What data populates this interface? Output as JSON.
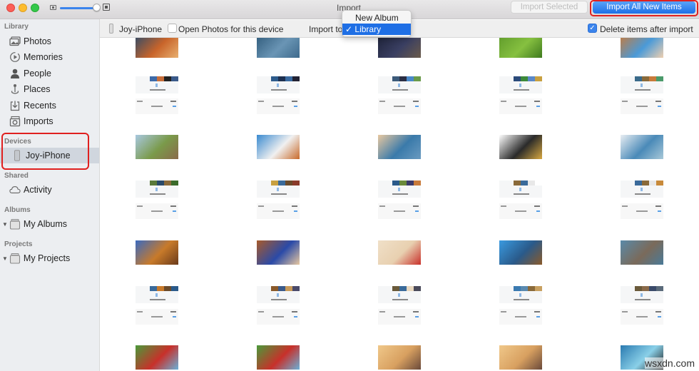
{
  "window": {
    "title": "Import",
    "zoom_slider_value_fraction": 0.9
  },
  "toolbar_top": {
    "import_selected_label": "Import Selected",
    "import_selected_enabled": false,
    "import_all_label": "Import All New Items",
    "accent_color": "#1f6fe5",
    "highlight_color": "#e0201f"
  },
  "sidebar": {
    "sections": [
      {
        "label": "Library",
        "items": [
          {
            "label": "Photos",
            "icon": "photos-icon"
          },
          {
            "label": "Memories",
            "icon": "memories-icon"
          },
          {
            "label": "People",
            "icon": "people-icon"
          },
          {
            "label": "Places",
            "icon": "places-icon"
          },
          {
            "label": "Recents",
            "icon": "recents-icon"
          },
          {
            "label": "Imports",
            "icon": "imports-icon"
          }
        ]
      },
      {
        "label": "Devices",
        "items": [
          {
            "label": "Joy-iPhone",
            "icon": "iphone-icon",
            "selected": true
          }
        ]
      },
      {
        "label": "Shared",
        "items": [
          {
            "label": "Activity",
            "icon": "cloud-icon"
          }
        ]
      },
      {
        "label": "Albums",
        "items": [
          {
            "label": "My Albums",
            "icon": "folder-icon",
            "expandable": true
          }
        ]
      },
      {
        "label": "Projects",
        "items": [
          {
            "label": "My Projects",
            "icon": "folder-icon",
            "expandable": true
          }
        ]
      }
    ]
  },
  "toolbar": {
    "device_name": "Joy-iPhone",
    "open_photos_label": "Open Photos for this device",
    "open_photos_checked": false,
    "import_to_label": "Import to",
    "import_to_options": [
      "New Album",
      "Library"
    ],
    "import_to_selected": "Library",
    "delete_after_label": "Delete items after import",
    "delete_after_checked": true
  },
  "grid": {
    "columns": 5,
    "rows": [
      {
        "type": "photo",
        "items": [
          {
            "desc": "roaring lion close-up",
            "colors": [
              "#2a4a6a",
              "#c8642a",
              "#e8b070"
            ]
          },
          {
            "desc": "blue ocean scene",
            "colors": [
              "#2f5a7a",
              "#6a95b5",
              "#3e6a8c"
            ]
          },
          {
            "desc": "night pirate ship",
            "colors": [
              "#1d2238",
              "#3a3f62",
              "#6a5a4a"
            ]
          },
          {
            "desc": "green meadow",
            "colors": [
              "#5e9a2a",
              "#86c040",
              "#3f7a1e"
            ]
          },
          {
            "desc": "cartoon collage",
            "colors": [
              "#c87a3a",
              "#4a9ad8",
              "#f0d0b0"
            ]
          }
        ]
      },
      {
        "type": "screenshot-strip",
        "items": [
          {
            "colors": [
              "#3d6aa8",
              "#c86e3a",
              "#222",
              "#3a5a8a"
            ]
          },
          {
            "colors": [
              "#2e5c8c",
              "#1e3050",
              "#3a6aa0",
              "#223"
            ]
          },
          {
            "colors": [
              "#3c5a7a",
              "#2a2e44",
              "#4a88c8",
              "#6a9a4a"
            ]
          },
          {
            "colors": [
              "#2a4a7a",
              "#3c8a3a",
              "#5a88c8",
              "#c8a040"
            ]
          },
          {
            "colors": [
              "#3a6a8a",
              "#8a6a3a",
              "#c87a3a",
              "#4a9a6a"
            ]
          }
        ]
      },
      {
        "type": "info-card",
        "items": [
          {},
          {},
          {},
          {},
          {}
        ]
      },
      {
        "type": "photo",
        "items": [
          {
            "desc": "donkey cartoon",
            "colors": [
              "#a8c8e0",
              "#7a9a4a",
              "#8a6a4a"
            ]
          },
          {
            "desc": "panda cartoon",
            "colors": [
              "#3a8ad0",
              "#f0f0f0",
              "#c86a2a"
            ]
          },
          {
            "desc": "ocean wave",
            "colors": [
              "#e8c8a0",
              "#3a7aaa",
              "#6a9ac0"
            ]
          },
          {
            "desc": "wedding with minions",
            "colors": [
              "#ffffff",
              "#2a2a2a",
              "#d8a840"
            ]
          },
          {
            "desc": "whale illustration",
            "colors": [
              "#e8eef2",
              "#4a8ab8",
              "#a8c8d8"
            ]
          }
        ]
      },
      {
        "type": "screenshot-strip",
        "items": [
          {
            "colors": [
              "#5a7a3a",
              "#2a4a6a",
              "#8a6a3a",
              "#3a6a2a"
            ]
          },
          {
            "colors": [
              "#c8a040",
              "#3a6a9a",
              "#6a4a2a",
              "#8a3a2a"
            ]
          },
          {
            "colors": [
              "#2a5a8a",
              "#6a8a3a",
              "#3a3a6a",
              "#c87a3a"
            ]
          },
          {
            "colors": [
              "#8a6a3a",
              "#3a6a9a",
              "#e8e8e8",
              "#ffffff"
            ]
          },
          {
            "colors": [
              "#3a6a9a",
              "#8a6a3a",
              "#e8e8e8",
              "#c88a3a"
            ]
          }
        ]
      },
      {
        "type": "info-card",
        "items": [
          {},
          {},
          {},
          {},
          {}
        ]
      },
      {
        "type": "photo",
        "items": [
          {
            "desc": "autumn forest",
            "colors": [
              "#3a6ac0",
              "#c87a2a",
              "#6a3a1a"
            ]
          },
          {
            "desc": "canyon cartoon",
            "colors": [
              "#a85a2a",
              "#2a4aa8",
              "#e8c8a0"
            ]
          },
          {
            "desc": "red flower on cream",
            "colors": [
              "#f0e0c8",
              "#e8d0b0",
              "#c8302a"
            ]
          },
          {
            "desc": "squirrel on blue",
            "colors": [
              "#3a9ae0",
              "#2a5a8a",
              "#8a5a2a"
            ]
          },
          {
            "desc": "balloon house",
            "colors": [
              "#5a8aa8",
              "#7a6a5a",
              "#4a7a98"
            ]
          }
        ]
      },
      {
        "type": "screenshot-strip",
        "items": [
          {
            "colors": [
              "#3a6a9a",
              "#c87a2a",
              "#6a4a2a",
              "#2a5a8a"
            ]
          },
          {
            "colors": [
              "#8a5a2a",
              "#3a5a8a",
              "#c89a5a",
              "#4a4a6a"
            ]
          },
          {
            "colors": [
              "#6a5a3a",
              "#3a6a9a",
              "#e8d8c0",
              "#4a4a5a"
            ]
          },
          {
            "colors": [
              "#3a7ab0",
              "#5a8ab0",
              "#8a6a3a",
              "#c8a060"
            ]
          },
          {
            "colors": [
              "#6a5a3a",
              "#8a6a4a",
              "#3a4a6a",
              "#5a6a7a"
            ]
          }
        ]
      },
      {
        "type": "info-card",
        "items": [
          {},
          {},
          {},
          {},
          {}
        ]
      },
      {
        "type": "photo",
        "items": [
          {
            "desc": "red bird under tree",
            "colors": [
              "#4a9a3a",
              "#c8302a",
              "#6ab0d8"
            ]
          },
          {
            "desc": "red bird under tree",
            "colors": [
              "#4a9a3a",
              "#c8302a",
              "#6ab0d8"
            ]
          },
          {
            "desc": "sepia fairy",
            "colors": [
              "#f0c88a",
              "#d8a060",
              "#6a4a3a"
            ]
          },
          {
            "desc": "sepia fairy",
            "colors": [
              "#f0c88a",
              "#d8a060",
              "#6a4a3a"
            ]
          },
          {
            "desc": "mickey silhouette blue",
            "colors": [
              "#2a7ab0",
              "#8ad0e8",
              "#1a1a1a"
            ]
          }
        ]
      }
    ]
  },
  "watermark": "wsxdn.com"
}
